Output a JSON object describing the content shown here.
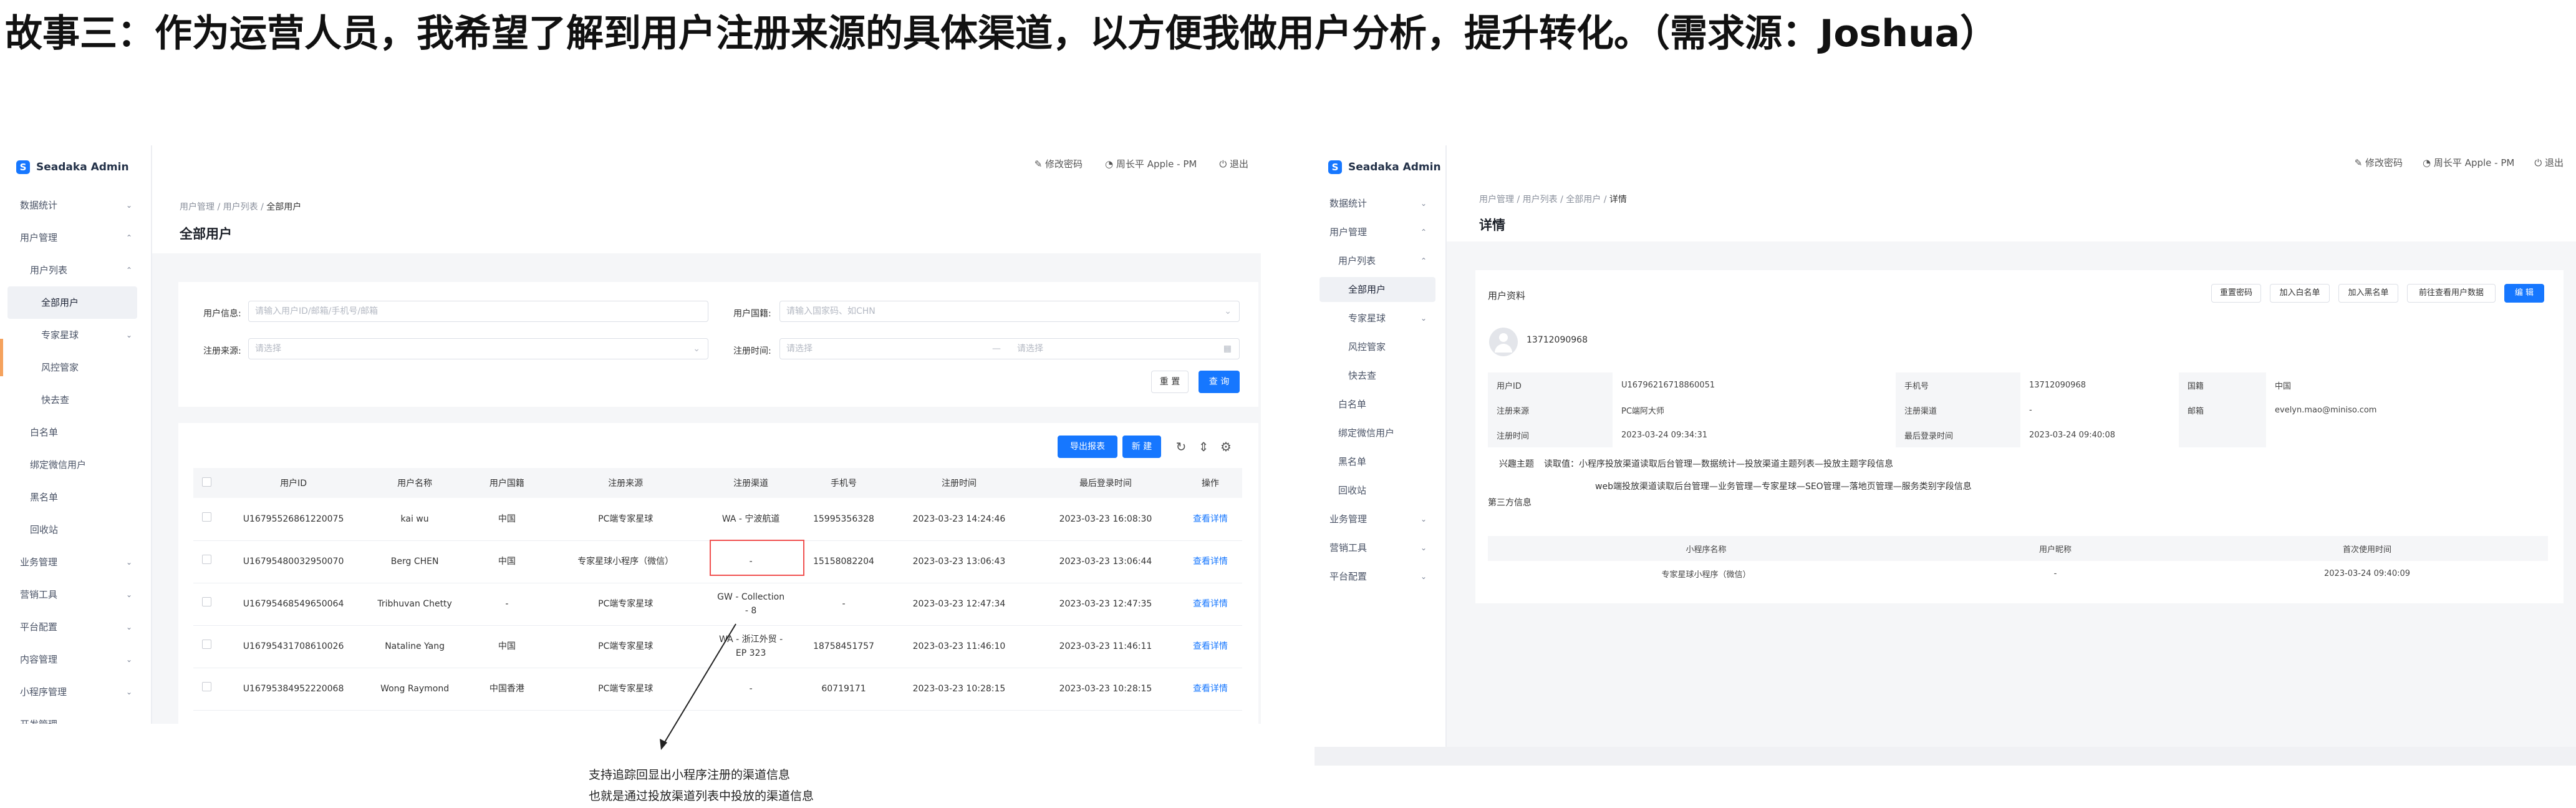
{
  "story_title": "故事三：作为运营人员，我希望了解到用户注册来源的具体渠道，以方便我做用户分析，提升转化。（需求源：Joshua）",
  "app_name": "Seadaka Admin",
  "topbar": {
    "change_password": "修改密码",
    "user": "周长平 Apple - PM",
    "logout": "退出"
  },
  "sidebar": {
    "data_stats": "数据统计",
    "user_mgmt": "用户管理",
    "user_list": "用户列表",
    "all_users": "全部用户",
    "expert_planet": "专家星球",
    "risk_mgmt": "风控管家",
    "kuaiqu": "快去查",
    "whitelist": "白名单",
    "wechat_bound": "绑定微信用户",
    "blacklist": "黑名单",
    "recycle": "回收站",
    "business_mgmt": "业务管理",
    "marketing": "营销工具",
    "platform_config": "平台配置",
    "content_mgmt": "内容管理",
    "miniprogram_mgmt": "小程序管理",
    "dev_mgmt": "开发管理"
  },
  "list_page": {
    "breadcrumb": [
      "用户管理",
      "用户列表",
      "全部用户"
    ],
    "title": "全部用户",
    "filters": {
      "user_info_label": "用户信息:",
      "user_info_placeholder": "请输入用户ID/邮箱/手机号/邮箱",
      "country_label": "用户国籍:",
      "country_placeholder": "请输入国家码、如CHN",
      "source_label": "注册来源:",
      "source_placeholder": "请选择",
      "time_label": "注册时间:",
      "time_start": "请选择",
      "time_sep": "—",
      "time_end": "请选择",
      "reset": "重 置",
      "search": "查 询"
    },
    "export": "导出报表",
    "create": "新 建",
    "columns": [
      "用户ID",
      "用户名称",
      "用户国籍",
      "注册来源",
      "注册渠道",
      "手机号",
      "注册时间",
      "最后登录时间",
      "操作"
    ],
    "rows": [
      {
        "id": "U16795526861220075",
        "name": "kai wu",
        "country": "中国",
        "source": "PC端专家星球",
        "channel": "WA - 宁波航道",
        "phone": "15995356328",
        "reg": "2023-03-23 14:24:46",
        "last": "2023-03-23 16:08:30",
        "op": "查看详情"
      },
      {
        "id": "U16795480032950070",
        "name": "Berg CHEN",
        "country": "中国",
        "source": "专家星球小程序（微信）",
        "channel": "-",
        "phone": "15158082204",
        "reg": "2023-03-23 13:06:43",
        "last": "2023-03-23 13:06:44",
        "op": "查看详情"
      },
      {
        "id": "U16795468549650064",
        "name": "Tribhuvan Chetty",
        "country": "-",
        "source": "PC端专家星球",
        "channel": "GW - Collection - 8",
        "phone": "-",
        "reg": "2023-03-23 12:47:34",
        "last": "2023-03-23 12:47:35",
        "op": "查看详情"
      },
      {
        "id": "U16795431708610026",
        "name": "Nataline Yang",
        "country": "中国",
        "source": "PC端专家星球",
        "channel": "WA - 浙江外贸 - EP 323",
        "phone": "18758451757",
        "reg": "2023-03-23 11:46:10",
        "last": "2023-03-23 11:46:11",
        "op": "查看详情"
      },
      {
        "id": "U16795384952220068",
        "name": "Wong Raymond",
        "country": "中国香港",
        "source": "PC端专家星球",
        "channel": "-",
        "phone": "60719171",
        "reg": "2023-03-23 10:28:15",
        "last": "2023-03-23 10:28:15",
        "op": "查看详情"
      }
    ],
    "annotation": [
      "支持追踪回显出小程序注册的渠道信息",
      "也就是通过投放渠道列表中投放的渠道信息"
    ]
  },
  "detail_page": {
    "breadcrumb": [
      "用户管理",
      "用户列表",
      "全部用户",
      "详情"
    ],
    "title": "详情",
    "section_label": "用户资料",
    "buttons": [
      "重置密码",
      "加入白名单",
      "加入黑名单",
      "前往查看用户数据",
      "编 辑"
    ],
    "phone_display": "13712090968",
    "fields": [
      {
        "k1": "用户ID",
        "v1": "U16796216718860051",
        "k2": "手机号",
        "v2": "13712090968",
        "k3": "国籍",
        "v3": "中国"
      },
      {
        "k1": "注册来源",
        "v1": "PC端阿大师",
        "k2": "注册渠道",
        "v2": "-",
        "k3": "邮箱",
        "v3": "evelyn.mao@miniso.com"
      },
      {
        "k1": "注册时间",
        "v1": "2023-03-24 09:34:31",
        "k2": "最后登录时间",
        "v2": "2023-03-24 09:40:08",
        "k3": "",
        "v3": ""
      }
    ],
    "interest_label": "兴趣主题",
    "interest_text": "读取值：小程序投放渠道读取后台管理—数据统计—投放渠道主题列表—投放主题字段信息",
    "interest_text2": "web端投放渠道读取后台管理—业务管理—专家星球—SEO管理—落地页管理—服务类别字段信息",
    "third_party_label": "第三方信息",
    "third_columns": [
      "小程序名称",
      "用户昵称",
      "首次使用时间"
    ],
    "third_rows": [
      {
        "name": "专家星球小程序（微信）",
        "nick": "-",
        "first": "2023-03-24 09:40:09"
      }
    ]
  }
}
